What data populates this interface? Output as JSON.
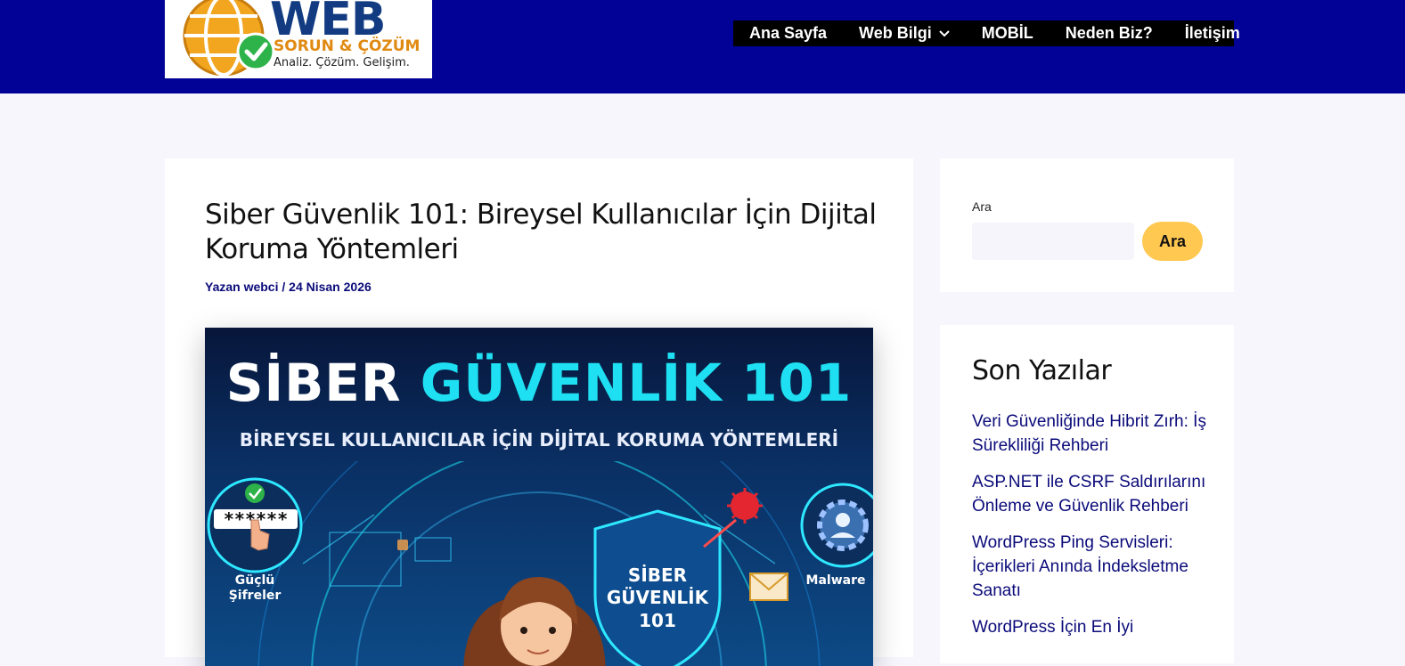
{
  "header": {
    "logo": {
      "title": "WEB",
      "subtitle": "SORUN & ÇÖZÜM",
      "tagline": "Analiz. Çözüm. Gelişim."
    },
    "nav": [
      {
        "label": "Ana Sayfa",
        "has_dropdown": false
      },
      {
        "label": "Web Bilgi",
        "has_dropdown": true
      },
      {
        "label": "MOBİL",
        "has_dropdown": false
      },
      {
        "label": "Neden Biz?",
        "has_dropdown": false
      },
      {
        "label": "İletişim",
        "has_dropdown": false
      }
    ]
  },
  "article": {
    "title": "Siber Güvenlik 101: Bireysel Kullanıcılar İçin Dijital Koruma Yöntemleri",
    "meta": "Yazan webci / 24 Nisan 2026",
    "hero": {
      "heading_white": "SİBER ",
      "heading_cyan": "GÜVENLİK 101",
      "subheading": "BİREYSEL KULLANICILAR İÇİN DİJİTAL KORUMA YÖNTEMLERİ",
      "left_caption_line1": "Güçlü",
      "left_caption_line2": "Şifreler",
      "right_caption": "Malware",
      "shield_line1": "SİBER",
      "shield_line2": "GÜVENLİK",
      "shield_line3": "101",
      "password_mask": "******"
    }
  },
  "sidebar": {
    "search": {
      "label": "Ara",
      "placeholder": "",
      "button": "Ara"
    },
    "recent": {
      "title": "Son Yazılar",
      "items": [
        "Veri Güvenliğinde Hibrit Zırh: İş Sürekliliği Rehberi",
        "ASP.NET ile CSRF Saldırılarını Önleme ve Güvenlik Rehberi",
        "WordPress Ping Servisleri: İçerikleri Anında İndeksletme Sanatı",
        "WordPress İçin En İyi"
      ]
    }
  },
  "colors": {
    "header_bg": "#020297",
    "nav_bg": "#000000",
    "link": "#0b0b7a",
    "button": "#ffc851",
    "page_bg": "#f7f6fd"
  }
}
